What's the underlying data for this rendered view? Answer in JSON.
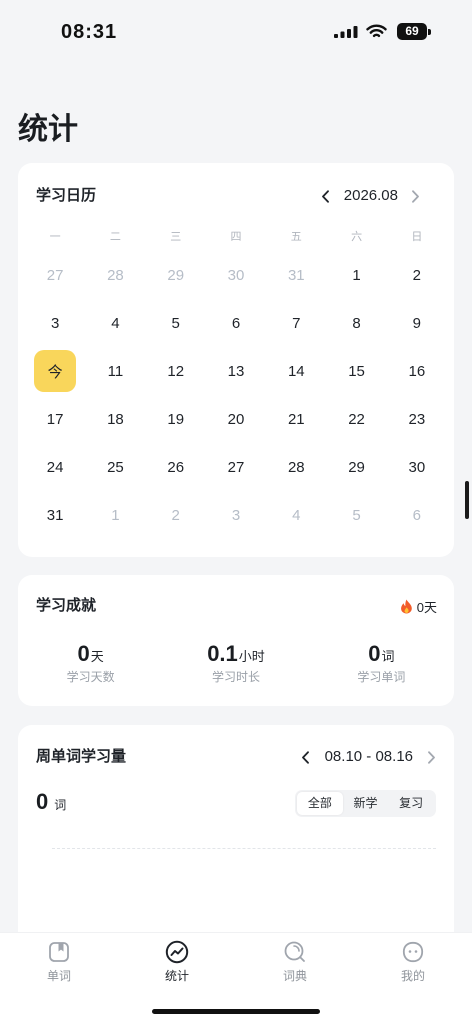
{
  "status_bar": {
    "time": "08:31",
    "battery": "69",
    "icons": [
      "signal-icon",
      "wifi-icon",
      "battery-icon"
    ]
  },
  "page_title": "统计",
  "calendar": {
    "title": "学习日历",
    "month": "2026.08",
    "weekdays": [
      "一",
      "二",
      "三",
      "四",
      "五",
      "六",
      "日"
    ],
    "weeks": [
      [
        {
          "day": "27",
          "muted": true
        },
        {
          "day": "28",
          "muted": true
        },
        {
          "day": "29",
          "muted": true
        },
        {
          "day": "30",
          "muted": true
        },
        {
          "day": "31",
          "muted": true
        },
        {
          "day": "1"
        },
        {
          "day": "2"
        }
      ],
      [
        {
          "day": "3"
        },
        {
          "day": "4"
        },
        {
          "day": "5"
        },
        {
          "day": "6"
        },
        {
          "day": "7"
        },
        {
          "day": "8"
        },
        {
          "day": "9"
        }
      ],
      [
        {
          "day": "今",
          "today": true
        },
        {
          "day": "11"
        },
        {
          "day": "12"
        },
        {
          "day": "13"
        },
        {
          "day": "14"
        },
        {
          "day": "15"
        },
        {
          "day": "16"
        }
      ],
      [
        {
          "day": "17"
        },
        {
          "day": "18"
        },
        {
          "day": "19"
        },
        {
          "day": "20"
        },
        {
          "day": "21"
        },
        {
          "day": "22"
        },
        {
          "day": "23"
        }
      ],
      [
        {
          "day": "24"
        },
        {
          "day": "25"
        },
        {
          "day": "26"
        },
        {
          "day": "27"
        },
        {
          "day": "28"
        },
        {
          "day": "29"
        },
        {
          "day": "30"
        }
      ],
      [
        {
          "day": "31"
        },
        {
          "day": "1",
          "muted": true
        },
        {
          "day": "2",
          "muted": true
        },
        {
          "day": "3",
          "muted": true
        },
        {
          "day": "4",
          "muted": true
        },
        {
          "day": "5",
          "muted": true
        },
        {
          "day": "6",
          "muted": true
        }
      ]
    ]
  },
  "achievement": {
    "title": "学习成就",
    "streak_icon": "fire-icon",
    "streak": "0天",
    "stats": [
      {
        "value": "0",
        "unit": "天",
        "label": "学习天数"
      },
      {
        "value": "0.1",
        "unit": "小时",
        "label": "学习时长"
      },
      {
        "value": "0",
        "unit": "词",
        "label": "学习单词"
      }
    ]
  },
  "weekly": {
    "title": "周单词学习量",
    "range": "08.10 - 08.16",
    "count": "0",
    "count_unit": "词",
    "filters": [
      {
        "label": "全部",
        "selected": true
      },
      {
        "label": "新学",
        "selected": false
      },
      {
        "label": "复习",
        "selected": false
      }
    ]
  },
  "tabbar": {
    "items": [
      {
        "label": "单词",
        "icon": "book-icon",
        "active": false
      },
      {
        "label": "统计",
        "icon": "chart-icon",
        "active": true
      },
      {
        "label": "词典",
        "icon": "search-icon",
        "active": false
      },
      {
        "label": "我的",
        "icon": "face-icon",
        "active": false
      }
    ]
  },
  "colors": {
    "accent": "#F9D65B",
    "text": "#1F2329",
    "muted": "#B6BDC7",
    "background": "#F4F5F7",
    "fire": "#F25C2A"
  }
}
